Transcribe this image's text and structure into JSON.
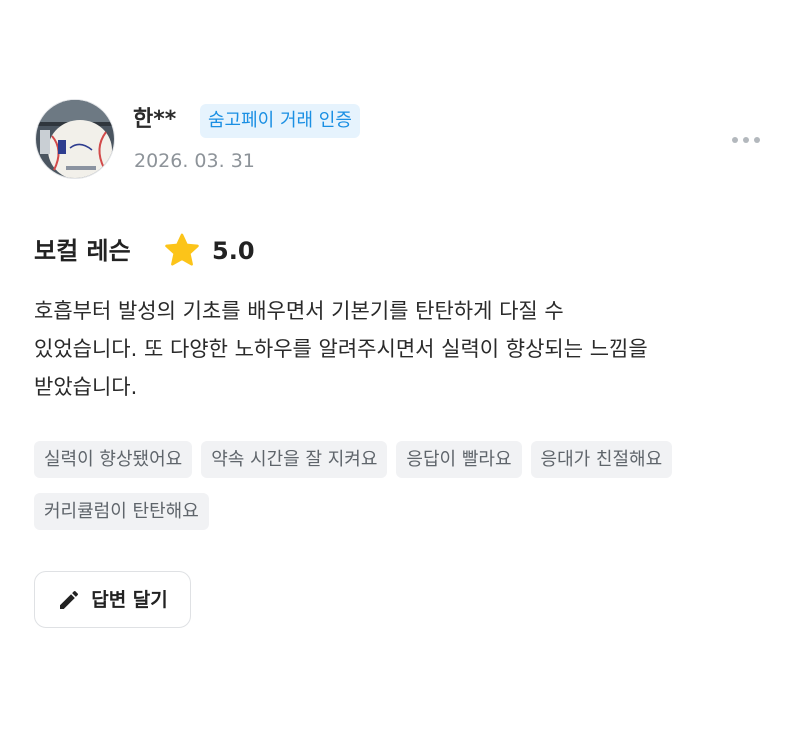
{
  "review": {
    "author_name": "한**",
    "verification_badge": "숨고페이 거래 인증",
    "date": "2026. 03. 31",
    "service": "보컬 레슨",
    "rating": "5.0",
    "rating_value": 5.0,
    "text_lines": [
      "호흡부터 발성의 기초를 배우면서 기본기를 탄탄하게 다질 수",
      "있었습니다. 또 다양한 노하우를 알려주시면서 실력이 향상되는 느낌을",
      "받았습니다."
    ],
    "tags": [
      "실력이 향상됐어요",
      "약속 시간을 잘 지켜요",
      "응답이 빨라요",
      "응대가 친절해요",
      "커리큘럼이 탄탄해요"
    ],
    "reply_button_label": "답변 달기"
  },
  "icons": {
    "more": "more-horizontal-icon",
    "star": "star-icon",
    "reply": "pencil-icon"
  },
  "colors": {
    "badge_bg": "#e6f3fd",
    "badge_text": "#1a8fe3",
    "star": "#fcc419",
    "tag_bg": "#f1f2f4",
    "tag_text": "#5f656b",
    "muted_text": "#8d9399"
  }
}
